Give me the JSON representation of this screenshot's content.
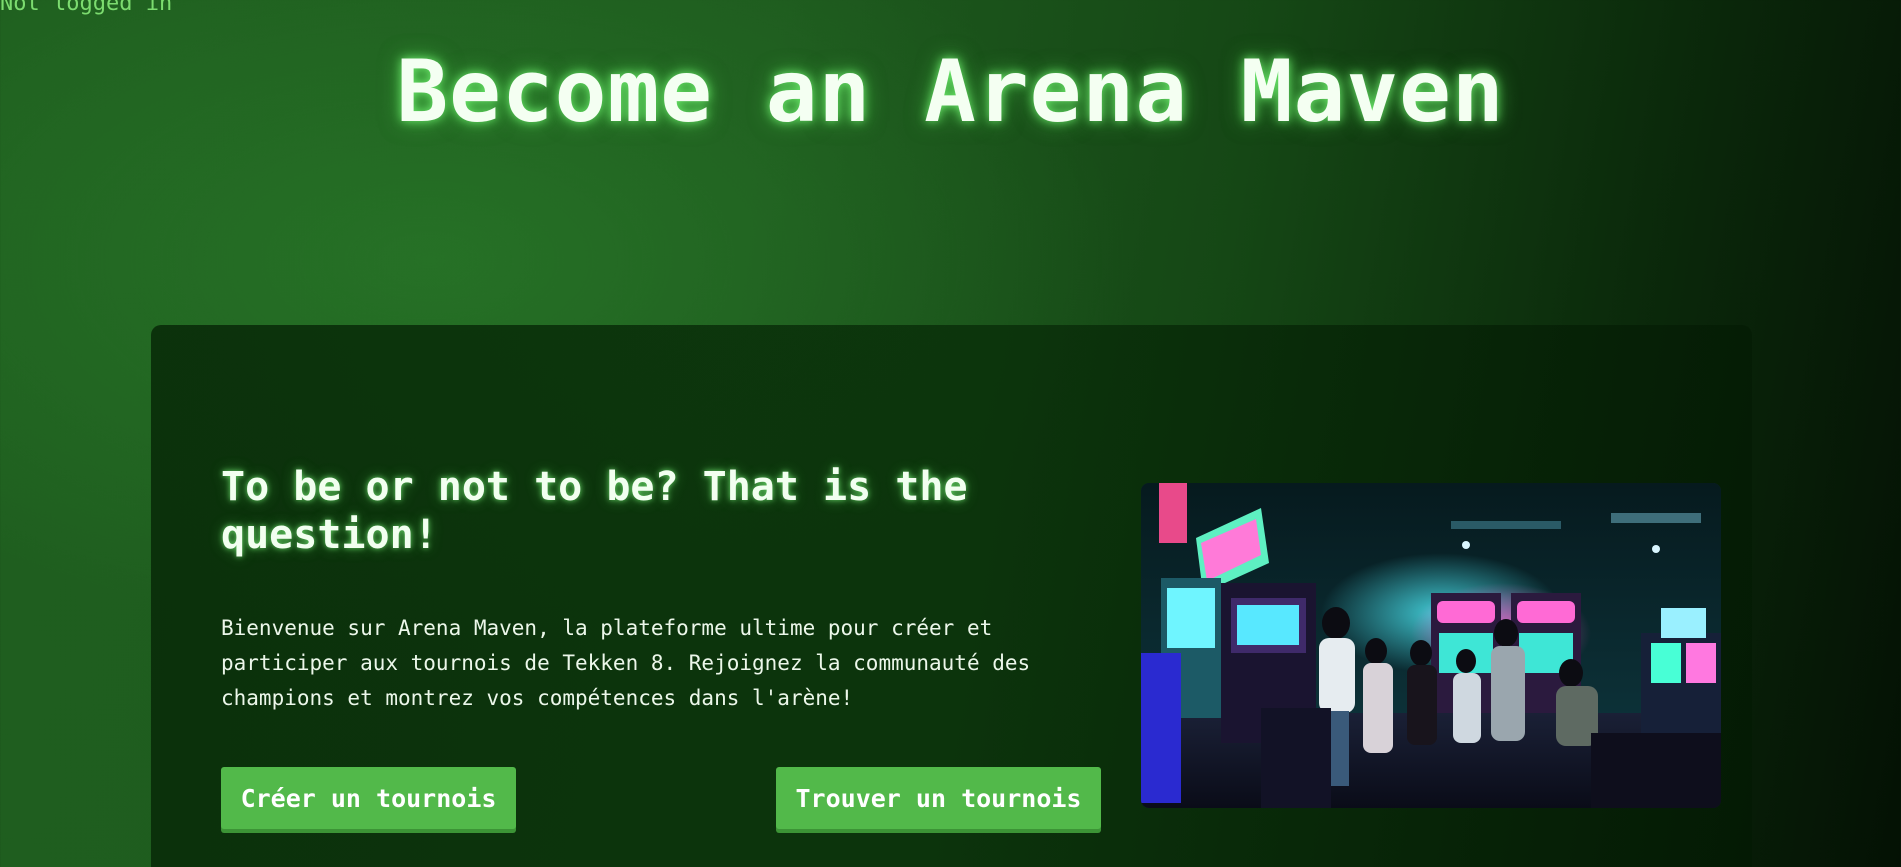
{
  "header": {
    "login_status": "Not logged in",
    "title": "Become an Arena Maven"
  },
  "hero": {
    "heading": "To be or not to be? That is the question!",
    "description": "Bienvenue sur Arena Maven, la plateforme ultime pour créer et participer aux tournois de Tekken 8. Rejoignez la communauté des champions et montrez vos compétences dans l'arène!",
    "buttons": {
      "create_label": "Créer un tournois",
      "find_label": "Trouver un tournois"
    },
    "image": {
      "subject": "neon-lit arcade with people playing cabinets"
    }
  },
  "colors": {
    "accent_button": "#52b94a",
    "background_green": "#1e5a1e",
    "title_glow": "#78ff78",
    "login_text": "#7cdc6f"
  }
}
